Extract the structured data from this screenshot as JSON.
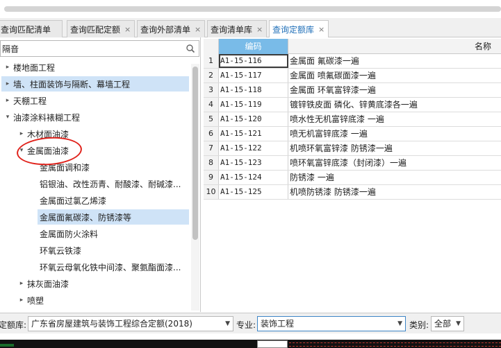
{
  "tabs": [
    {
      "label": "查询匹配清单",
      "close": "×"
    },
    {
      "label": "查询匹配定额",
      "close": "×"
    },
    {
      "label": "查询外部清单",
      "close": "×"
    },
    {
      "label": "查询清单库",
      "close": "×"
    },
    {
      "label": "查询定额库",
      "close": "×"
    }
  ],
  "search": {
    "value": "隔音",
    "icon": "search-icon"
  },
  "tree": [
    {
      "label": "楼地面工程",
      "arrow": "▸"
    },
    {
      "label": "墙、柱面装饰与隔断、幕墙工程",
      "arrow": "▸"
    },
    {
      "label": "天棚工程",
      "arrow": "▸"
    },
    {
      "label": "油漆涂料裱糊工程",
      "arrow": "▾"
    },
    {
      "label": "木材面油漆",
      "arrow": "▸"
    },
    {
      "label": "金属面油漆",
      "arrow": "▾"
    },
    {
      "label": "金属面调和漆",
      "arrow": ""
    },
    {
      "label": "铝银油、改性沥青、耐酸漆、耐碱漆...",
      "arrow": ""
    },
    {
      "label": "金属面过氯乙烯漆",
      "arrow": ""
    },
    {
      "label": "金属面氟碳漆、防锈漆等",
      "arrow": ""
    },
    {
      "label": "金属面防火涂料",
      "arrow": ""
    },
    {
      "label": "环氧云铁漆",
      "arrow": ""
    },
    {
      "label": "环氧云母氧化铁中间漆、聚氨酯面漆...",
      "arrow": ""
    },
    {
      "label": "抹灰面油漆",
      "arrow": "▸"
    },
    {
      "label": "喷塑",
      "arrow": "▸"
    }
  ],
  "grid": {
    "headers": {
      "code": "编码",
      "name": "名称"
    },
    "rows": [
      {
        "num": "1",
        "code": "A1-15-116",
        "name": "金属面 氟碳漆一遍"
      },
      {
        "num": "2",
        "code": "A1-15-117",
        "name": "金属面 喷氟碳面漆一遍"
      },
      {
        "num": "3",
        "code": "A1-15-118",
        "name": "金属面 环氧富锌漆一遍"
      },
      {
        "num": "4",
        "code": "A1-15-119",
        "name": "镀锌铁皮面 磷化、锌黄底漆各一遍"
      },
      {
        "num": "5",
        "code": "A1-15-120",
        "name": "喷水性无机富锌底漆 一遍"
      },
      {
        "num": "6",
        "code": "A1-15-121",
        "name": "喷无机富锌底漆 一遍"
      },
      {
        "num": "7",
        "code": "A1-15-122",
        "name": "机喷环氧富锌漆 防锈漆一遍"
      },
      {
        "num": "8",
        "code": "A1-15-123",
        "name": "喷环氧富锌底漆（封闭漆）一遍"
      },
      {
        "num": "9",
        "code": "A1-15-124",
        "name": "防锈漆 一遍"
      },
      {
        "num": "10",
        "code": "A1-15-125",
        "name": "机喷防锈漆 防锈漆一遍"
      }
    ]
  },
  "filters": {
    "library_label": "定额库:",
    "library_value": "广东省房屋建筑与装饰工程综合定额(2018)",
    "spec_label": "专业:",
    "spec_value": "装饰工程",
    "category_label": "类别:",
    "category_value": "全部",
    "dropdown_glyph": "▼"
  },
  "colors": {
    "accent": "#79bbe8",
    "selected": "#cfe3f7",
    "annotation": "#e0221b"
  }
}
